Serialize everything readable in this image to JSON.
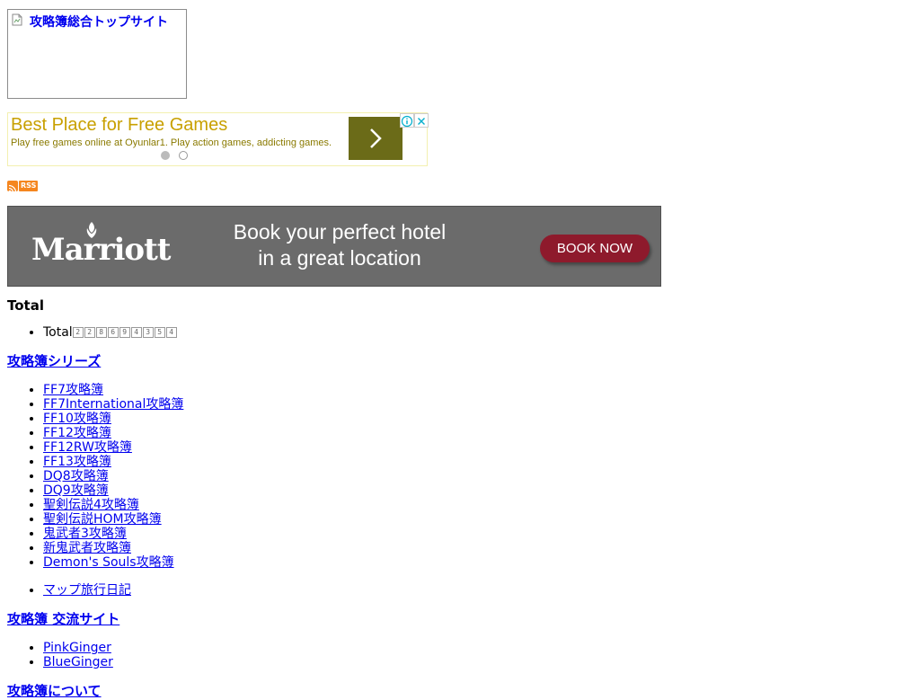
{
  "top_link": {
    "text": "攻略簿総合トップサイト"
  },
  "ad": {
    "title": "Best Place for Free Games",
    "subtitle": "Play free games online at Oyunlar1. Play action games, addicting games.",
    "arrow_icon": "chevron-right-icon",
    "info_icon": "ad-info-icon",
    "close_icon": "ad-close-icon"
  },
  "rss": {
    "label": "RSS",
    "icon": "rss-feed-icon"
  },
  "banner": {
    "brand": "Marriott",
    "message_line1": "Book your perfect hotel",
    "message_line2": "in a great location",
    "button": "BOOK NOW"
  },
  "total": {
    "heading": "Total",
    "item_label": "Total",
    "digits": [
      "2",
      "2",
      "8",
      "6",
      "9",
      "4",
      "3",
      "5",
      "4"
    ]
  },
  "series": {
    "heading": "攻略簿シリーズ",
    "items": [
      "FF7攻略簿",
      "FF7International攻略簿",
      "FF10攻略簿",
      "FF12攻略簿",
      "FF12RW攻略簿",
      "FF13攻略簿",
      "DQ8攻略簿",
      "DQ9攻略簿",
      "聖剣伝説4攻略簿",
      "聖剣伝説HOM攻略簿",
      "鬼武者3攻略簿",
      "新鬼武者攻略簿",
      "Demon's Souls攻略簿"
    ],
    "extra": "マップ旅行日記"
  },
  "exchange": {
    "heading": "攻略簿 交流サイト",
    "items": [
      "PinkGinger",
      "BlueGinger"
    ]
  },
  "about": {
    "heading": "攻略簿について"
  }
}
